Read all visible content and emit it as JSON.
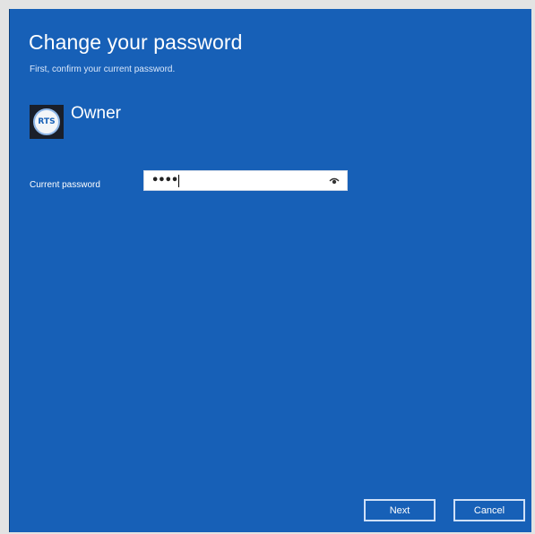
{
  "dialog": {
    "title": "Change your password",
    "subtitle": "First, confirm your current password.",
    "account": {
      "avatar_text": "RTS",
      "name": "Owner"
    },
    "current_password": {
      "label": "Current password",
      "value": "••••",
      "reveal_icon": "eye-icon"
    },
    "buttons": {
      "next": "Next",
      "cancel": "Cancel"
    }
  },
  "colors": {
    "background": "#1760b7",
    "text": "#ffffff",
    "button_border": "#cfe0f7"
  }
}
